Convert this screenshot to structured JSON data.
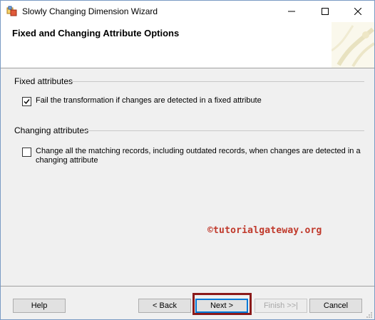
{
  "window": {
    "title": "Slowly Changing Dimension Wizard"
  },
  "header": {
    "title": "Fixed and Changing Attribute Options"
  },
  "fixed_group": {
    "label": "Fixed attributes",
    "checkbox_label": "Fail the transformation if changes are detected in a fixed attribute",
    "checked": true
  },
  "changing_group": {
    "label": "Changing attributes",
    "checkbox_label_line1": "Change all the matching records, including outdated records, when changes are detected in a",
    "checkbox_label_line2": "changing attribute",
    "checked": false
  },
  "watermark": "©tutorialgateway.org",
  "buttons": {
    "help": "Help",
    "back": "< Back",
    "next": "Next >",
    "finish": "Finish >>|",
    "cancel": "Cancel"
  },
  "colors": {
    "highlight": "#8b1a1a",
    "watermark": "#c0392b"
  }
}
